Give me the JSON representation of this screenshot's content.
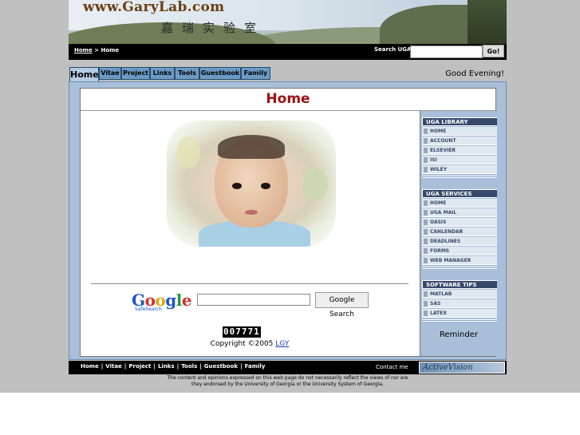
{
  "banner": {
    "site_name": "www.GaryLab.com",
    "chinese_title": "嘉瑞实验室"
  },
  "topbar": {
    "breadcrumb_home": "Home",
    "breadcrumb_sep": " > ",
    "breadcrumb_current": "Home",
    "search_label": "Search UGA",
    "search_value": "",
    "go_label": "Go!"
  },
  "tabs": [
    {
      "label": "Home"
    },
    {
      "label": "Vitae"
    },
    {
      "label": "Project"
    },
    {
      "label": "Links"
    },
    {
      "label": "Tools"
    },
    {
      "label": "Guestbook"
    },
    {
      "label": "Family"
    }
  ],
  "greeting": "Good Evening!",
  "page_title": "Home",
  "google": {
    "logo_parts": [
      "G",
      "o",
      "o",
      "g",
      "l",
      "e"
    ],
    "safesearch": "SafeSearch",
    "search_value": "",
    "button_label": "Google Search"
  },
  "counter": "007771",
  "copyright": {
    "text": "Copyright ©2005 ",
    "author": "LGY"
  },
  "sidebar": {
    "library": {
      "heading": "UGA LIBRARY",
      "items": [
        "HOME",
        "ACCOUNT",
        "ELSEVIER",
        "ISI",
        "WILEY"
      ]
    },
    "services": {
      "heading": "UGA SERVICES",
      "items": [
        "HOME",
        "UGA MAIL",
        "OASIS",
        "CANLENDAR",
        "DEADLINES",
        "FORMS",
        "WEB MANAGER"
      ]
    },
    "tips": {
      "heading": "SOFTWARE TIPS",
      "items": [
        "MATLAB",
        "SAS",
        "LATEX"
      ]
    },
    "reminder": "Reminder"
  },
  "footer": {
    "links": [
      "Home",
      "Vitae",
      "Project",
      "Links",
      "Tools",
      "Guestbook",
      "Family"
    ],
    "contact": "Contact me",
    "badge": "ActiveVision",
    "disclaimer_line1": "The content and opinions expressed on this web page do not necessarily reflect the views of nor are",
    "disclaimer_line2": "they endorsed by the University of Georgia or the University System of Georgia."
  },
  "colors": {
    "tab_bg": "#6b9bc5",
    "tab_active_bg": "#b5cbe0",
    "frame_bg": "#a9bfd9",
    "sidebar_heading_bg": "#37496b",
    "title_red": "#a01010"
  }
}
